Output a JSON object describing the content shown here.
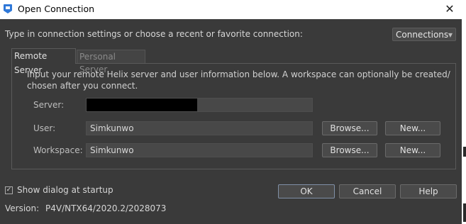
{
  "window": {
    "title": "Open Connection",
    "close_glyph": "✕"
  },
  "prompt": "Type in connection settings or choose a recent or favorite connection:",
  "connections_button": "Connections",
  "tabs": [
    {
      "label": "Remote Server",
      "active": true
    },
    {
      "label": "Personal Server",
      "active": false
    }
  ],
  "info_text": "Input your remote Helix server and user information below. A workspace can optionally be created/ chosen after you connect.",
  "fields": {
    "server": {
      "label": "Server:",
      "value": ""
    },
    "user": {
      "label": "User:",
      "value": "Simkunwo"
    },
    "workspace": {
      "label": "Workspace:",
      "value": "Simkunwo"
    }
  },
  "buttons": {
    "browse": "Browse...",
    "new": "New...",
    "ok": "OK",
    "cancel": "Cancel",
    "help": "Help"
  },
  "startup_checkbox": {
    "label": "Show dialog at startup",
    "checked": true
  },
  "version": {
    "label": "Version:",
    "value": "P4V/NTX64/2020.2/2028073"
  },
  "colors": {
    "dialog_bg": "#3a3a3a",
    "field_bg": "#484848",
    "accent": "#2f78d8"
  }
}
